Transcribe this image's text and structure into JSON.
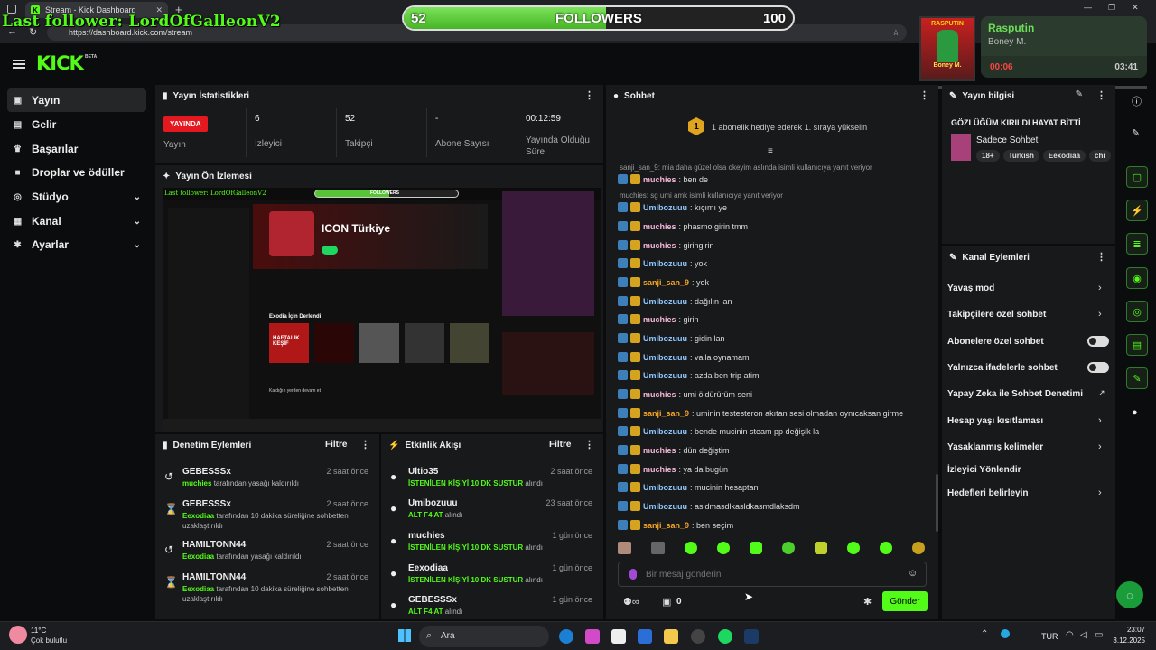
{
  "browser": {
    "tab_title": "Stream - Kick Dashboard",
    "url": "https://dashboard.kick.com/stream",
    "new_tab": "+"
  },
  "overlay": {
    "last_follower": "Last follower: LordOfGalleonV2",
    "followers_current": "52",
    "followers_label": "FOLLOWERS",
    "followers_goal": "100",
    "progress_fraction": 0.52
  },
  "music": {
    "album_text": "RASPUTIN",
    "album_brand": "Boney M.",
    "title": "Rasputin",
    "artist": "Boney M.",
    "elapsed": "00:06",
    "total": "03:41",
    "progress_fraction": 0.03
  },
  "header": {
    "logo": "KICK",
    "beta": "BETA"
  },
  "sidebar": {
    "items": [
      {
        "label": "Yayın",
        "icon": "video-icon"
      },
      {
        "label": "Gelir",
        "icon": "wallet-icon"
      },
      {
        "label": "Başarılar",
        "icon": "trophy-icon"
      },
      {
        "label": "Droplar ve ödüller",
        "icon": "gift-icon"
      },
      {
        "label": "Stüdyo",
        "icon": "studio-icon"
      },
      {
        "label": "Kanal",
        "icon": "channel-icon"
      },
      {
        "label": "Ayarlar",
        "icon": "gear-icon"
      }
    ]
  },
  "stats": {
    "title": "Yayın İstatistikleri",
    "live_badge": "YAYINDA",
    "status_label": "Yayın",
    "viewers": "6",
    "viewers_label": "İzleyici",
    "followers": "52",
    "followers_label": "Takipçi",
    "subs": "-",
    "subs_label": "Abone Sayısı",
    "duration": "00:12:59",
    "duration_label": "Yayında Olduğu Süre"
  },
  "preview": {
    "title": "Yayın Ön İzlemesi",
    "mock_title": "ICON Türkiye",
    "mock_section": "Exodia İçin Derlendi",
    "mock_card": "HAFTALIK KEŞİF",
    "mock_footer": "Kaldığın yerden devam et",
    "mock_overlay": "Last follower: LordOfGalleonV2",
    "mock_followers": "FOLLOWERS"
  },
  "moderation": {
    "title": "Denetim Eylemleri",
    "filter": "Filtre",
    "rows": [
      {
        "name": "GEBESSSx",
        "time": "2 saat önce",
        "actor": "muchies",
        "text": " tarafından yasağı kaldırıldı"
      },
      {
        "name": "GEBESSSx",
        "time": "2 saat önce",
        "actor": "Eexodiaa",
        "text": " tarafından 10 dakika süreliğine sohbetten uzaklaştırıldı"
      },
      {
        "name": "HAMILTONN44",
        "time": "2 saat önce",
        "actor": "Eexodiaa",
        "text": " tarafından yasağı kaldırıldı"
      },
      {
        "name": "HAMILTONN44",
        "time": "2 saat önce",
        "actor": "Eexodiaa",
        "text": " tarafından 10 dakika süreliğine sohbetten uzaklaştırıldı"
      }
    ]
  },
  "activity": {
    "title": "Etkinlik Akışı",
    "filter": "Filtre",
    "rows": [
      {
        "name": "Ultio35",
        "time": "2 saat önce",
        "reward": "İSTENİLEN KİŞİYİ 10 DK SUSTUR",
        "suffix": " alındı"
      },
      {
        "name": "Umibozuuu",
        "time": "23 saat önce",
        "reward": "ALT F4 AT",
        "suffix": " alındı"
      },
      {
        "name": "muchies",
        "time": "1 gün önce",
        "reward": "İSTENİLEN KİŞİYİ 10 DK SUSTUR",
        "suffix": " alındı"
      },
      {
        "name": "Eexodiaa",
        "time": "1 gün önce",
        "reward": "İSTENİLEN KİŞİYİ 10 DK SUSTUR",
        "suffix": " alındı"
      },
      {
        "name": "GEBESSSx",
        "time": "1 gün önce",
        "reward": "ALT F4 AT",
        "suffix": " alındı"
      }
    ]
  },
  "chat": {
    "title": "Sohbet",
    "pinned_rank": "1",
    "pinned": "1 abonelik hediye ederek 1. sıraya yükselin",
    "reply1": "sanji_san_9: mia daha güzel olsa okeyim aslında isimli kullanıcıya yanıt veriyor",
    "reply2": "muchies: sg umi amk isimli kullanıcıya yanıt veriyor",
    "messages": [
      {
        "user": "muchies",
        "color": "#f4b6d8",
        "text": ": ben de"
      },
      {
        "user": "Umibozuuu",
        "color": "#8fc7ff",
        "text": ": kıçımı ye"
      },
      {
        "user": "muchies",
        "color": "#f4b6d8",
        "text": ": phasmo girin tmm"
      },
      {
        "user": "muchies",
        "color": "#f4b6d8",
        "text": ": giringirin"
      },
      {
        "user": "Umibozuuu",
        "color": "#8fc7ff",
        "text": ": yok"
      },
      {
        "user": "sanji_san_9",
        "color": "#f5a623",
        "text": ": yok"
      },
      {
        "user": "Umibozuuu",
        "color": "#8fc7ff",
        "text": ": dağılın lan"
      },
      {
        "user": "muchies",
        "color": "#f4b6d8",
        "text": ": girin"
      },
      {
        "user": "Umibozuuu",
        "color": "#8fc7ff",
        "text": ": gidin lan"
      },
      {
        "user": "Umibozuuu",
        "color": "#8fc7ff",
        "text": ": valla oynamam"
      },
      {
        "user": "Umibozuuu",
        "color": "#8fc7ff",
        "text": ": azda ben trip atim"
      },
      {
        "user": "muchies",
        "color": "#f4b6d8",
        "text": ": umi öldürürüm seni"
      },
      {
        "user": "sanji_san_9",
        "color": "#f5a623",
        "text": ": uminin testesteron akıtan sesi olmadan oynıcaksan girme"
      },
      {
        "user": "Umibozuuu",
        "color": "#8fc7ff",
        "text": ": bende mucinin steam pp değişik la"
      },
      {
        "user": "muchies",
        "color": "#f4b6d8",
        "text": ": dün değiştim"
      },
      {
        "user": "muchies",
        "color": "#f4b6d8",
        "text": ": ya da bugün"
      },
      {
        "user": "Umibozuuu",
        "color": "#8fc7ff",
        "text": ": mucinin hesaptan"
      },
      {
        "user": "Umibozuuu",
        "color": "#8fc7ff",
        "text": ": asldmasdlkasldkasmdlaksdm"
      },
      {
        "user": "sanji_san_9",
        "color": "#f5a623",
        "text": ": ben seçim"
      }
    ],
    "placeholder": "Bir mesaj gönderin",
    "points": "0",
    "send": "Gönder"
  },
  "stream_info": {
    "title": "Yayın bilgisi",
    "stream_title": "GÖZLÜĞÜM KIRILDI HAYAT BİTTİ",
    "category": "Sadece Sohbet",
    "tags": [
      "18+",
      "Turkish",
      "Eexodiaa",
      "chi"
    ]
  },
  "channel_actions": {
    "title": "Kanal Eylemleri",
    "items": [
      "Yavaş mod",
      "Takipçilere özel sohbet",
      "Abonelere özel sohbet",
      "Yalnızca ifadelerle sohbet",
      "Yapay Zeka ile Sohbet Denetimi",
      "Hesap yaşı kısıtlaması",
      "Yasaklanmış kelimeler",
      "İzleyici Yönlendir",
      "Hedefleri belirleyin"
    ]
  },
  "taskbar": {
    "temp": "11°C",
    "weather": "Çok bulutlu",
    "search": "Ara",
    "lang": "TUR",
    "time": "23:07",
    "date": "3.12.2025"
  },
  "colors": {
    "accent": "#53fc18",
    "live": "#e4181f",
    "panel": "#18191b"
  }
}
